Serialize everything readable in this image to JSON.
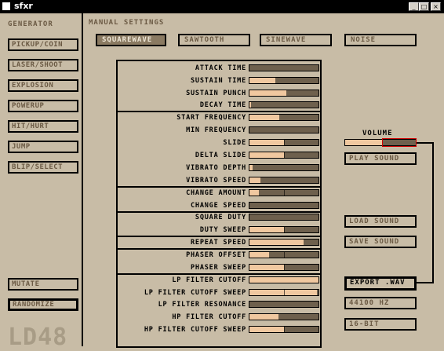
{
  "window": {
    "title": "sfxr"
  },
  "generator": {
    "header": "GENERATOR",
    "buttons": [
      "PICKUP/COIN",
      "LASER/SHOOT",
      "EXPLOSION",
      "POWERUP",
      "HIT/HURT",
      "JUMP",
      "BLIP/SELECT"
    ],
    "mutate": "MUTATE",
    "randomize": "RANDOMIZE",
    "logo": "LD48"
  },
  "manual": {
    "header": "MANUAL SETTINGS",
    "waves": [
      "SQUAREWAVE",
      "SAWTOOTH",
      "SINEWAVE",
      "NOISE"
    ],
    "selected_wave": "SQUAREWAVE"
  },
  "params": [
    {
      "label": "ATTACK TIME",
      "value": 0.0
    },
    {
      "label": "SUSTAIN TIME",
      "value": 0.38
    },
    {
      "label": "SUSTAIN PUNCH",
      "value": 0.53
    },
    {
      "label": "DECAY TIME",
      "value": 0.02
    },
    {
      "label": "START FREQUENCY",
      "value": 0.43
    },
    {
      "label": "MIN FREQUENCY",
      "value": 0.0
    },
    {
      "label": "SLIDE",
      "value": 0.5,
      "bipolar": true
    },
    {
      "label": "DELTA SLIDE",
      "value": 0.5,
      "bipolar": true
    },
    {
      "label": "VIBRATO DEPTH",
      "value": 0.04
    },
    {
      "label": "VIBRATO SPEED",
      "value": 0.16
    },
    {
      "label": "CHANGE AMOUNT",
      "value": 0.14,
      "bipolar": true
    },
    {
      "label": "CHANGE SPEED",
      "value": 0.0
    },
    {
      "label": "SQUARE DUTY",
      "value": 0.0
    },
    {
      "label": "DUTY SWEEP",
      "value": 0.5,
      "bipolar": true
    },
    {
      "label": "REPEAT SPEED",
      "value": 0.78
    },
    {
      "label": "PHASER OFFSET",
      "value": 0.28,
      "bipolar": true
    },
    {
      "label": "PHASER SWEEP",
      "value": 0.5,
      "bipolar": true
    },
    {
      "label": "LP FILTER CUTOFF",
      "value": 1.0
    },
    {
      "label": "LP FILTER CUTOFF SWEEP",
      "value": 0.98,
      "bipolar": true
    },
    {
      "label": "LP FILTER RESONANCE",
      "value": 0.0
    },
    {
      "label": "HP FILTER CUTOFF",
      "value": 0.42
    },
    {
      "label": "HP FILTER CUTOFF SWEEP",
      "value": 0.5,
      "bipolar": true
    }
  ],
  "volume": {
    "label": "VOLUME",
    "value": 0.52
  },
  "right_buttons": {
    "play": "PLAY SOUND",
    "load": "LOAD SOUND",
    "save": "SAVE SOUND",
    "export": "EXPORT .WAV",
    "rate": "44100 HZ",
    "bits": "16-BIT"
  },
  "colors": {
    "bg": "#c8bca6",
    "fill": "#f0c8a0",
    "track": "#6e604d",
    "text": "#6b5a44",
    "accent": "#cc0000"
  }
}
